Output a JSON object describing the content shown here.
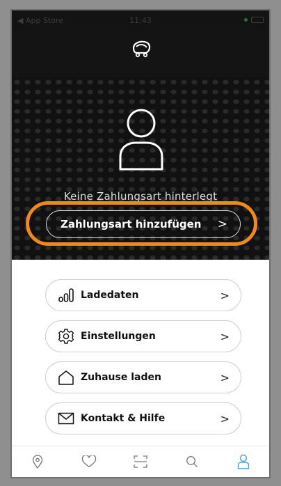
{
  "status_bar": {
    "left": "◀ App Store",
    "time": "11:43"
  },
  "hero": {
    "no_payment_text": "Keine Zahlungsart hinterlegt",
    "add_payment_label": "Zahlungsart hinzufügen",
    "highlight_color": "#f08a17"
  },
  "menu": {
    "items": [
      {
        "label": "Ladedaten",
        "icon": "bars-chart-icon"
      },
      {
        "label": "Einstellungen",
        "icon": "gear-icon"
      },
      {
        "label": "Zuhause laden",
        "icon": "home-icon"
      },
      {
        "label": "Kontakt & Hilfe",
        "icon": "mail-icon"
      }
    ],
    "chevron": ">"
  },
  "tabbar": {
    "tabs": [
      "map-pin-icon",
      "heart-icon",
      "scan-icon",
      "search-icon",
      "profile-icon"
    ],
    "active": "profile-icon",
    "active_color": "#4aa3dc"
  }
}
